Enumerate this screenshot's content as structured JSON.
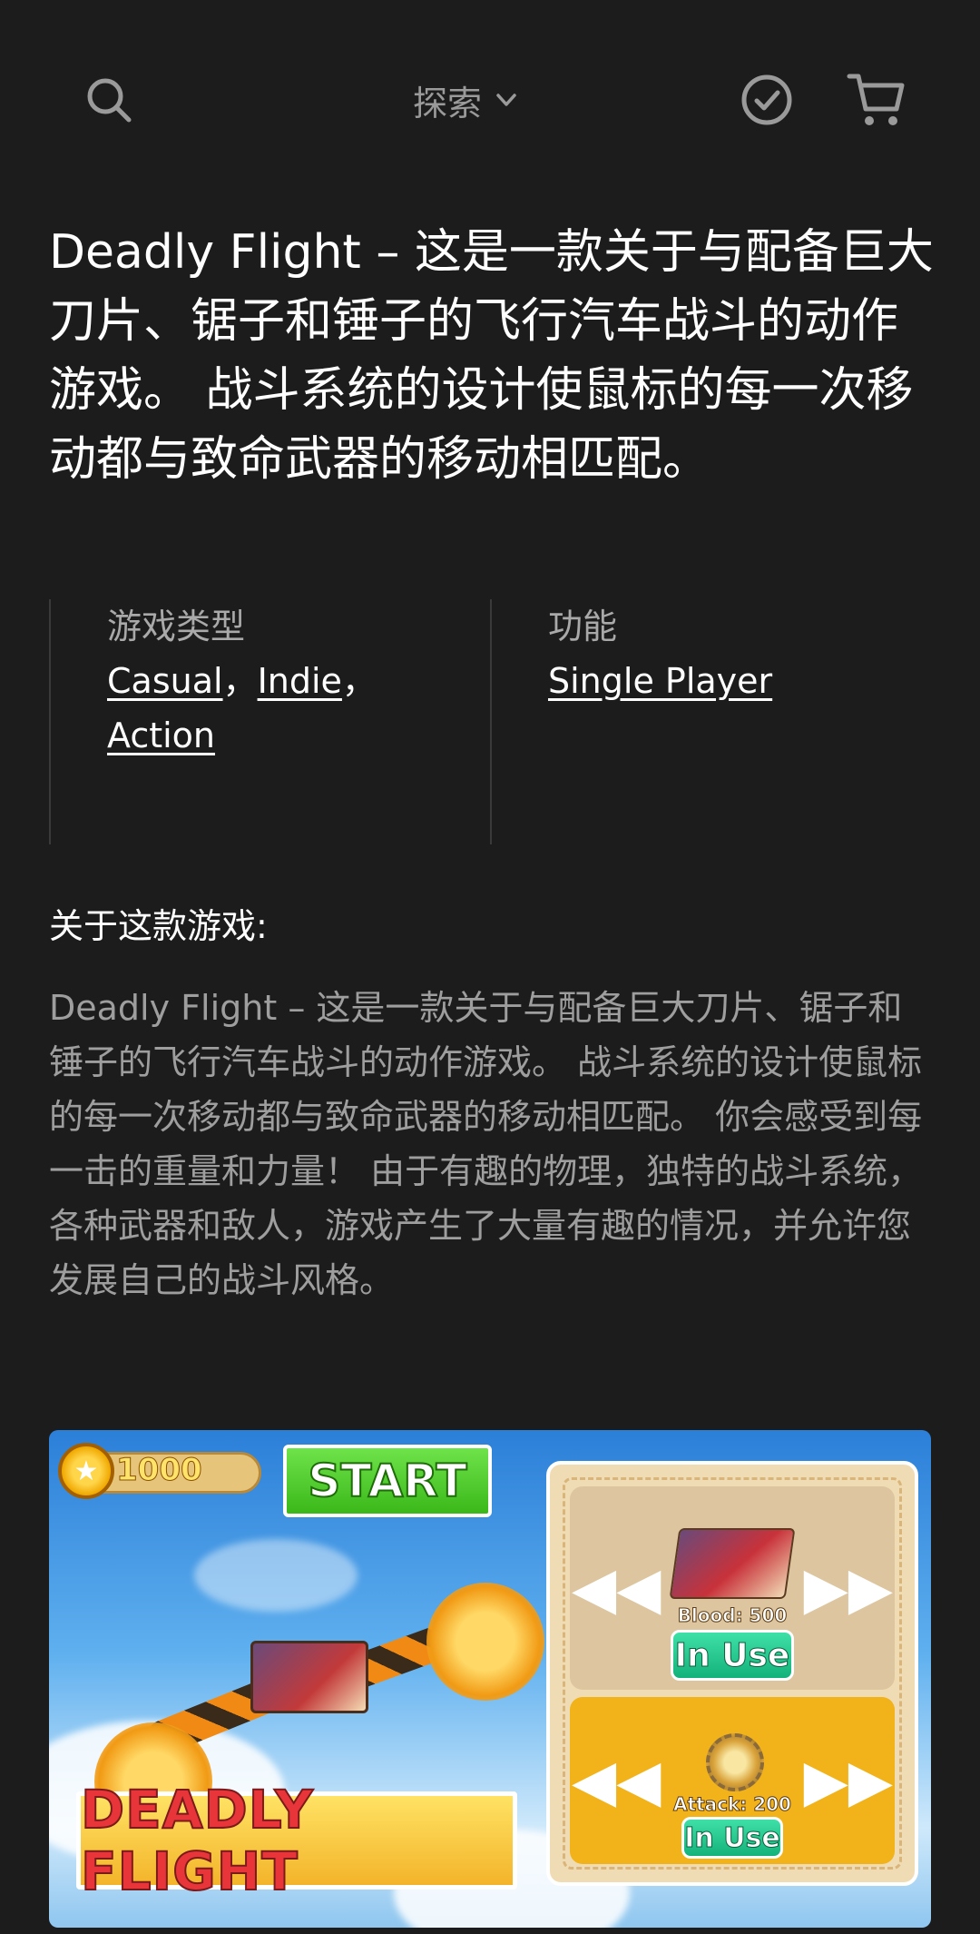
{
  "topbar": {
    "nav_label": "探索",
    "icons": [
      "search-icon",
      "chevron-down-icon",
      "check-circle-icon",
      "cart-icon"
    ]
  },
  "headline": "Deadly Flight – 这是一款关于与配备巨大刀片、锯子和锤子的飞行汽车战斗的动作游戏。 战斗系统的设计使鼠标的每一次移动都与致命武器的移动相匹配。",
  "meta": {
    "genres_title": "游戏类型",
    "genres": [
      "Casual",
      "Indie",
      "Action"
    ],
    "separator": "，",
    "features_title": "功能",
    "features": [
      "Single Player"
    ]
  },
  "about": {
    "title": "关于这款游戏:",
    "body": "Deadly Flight – 这是一款关于与配备巨大刀片、锯子和锤子的飞行汽车战斗的动作游戏。 战斗系统的设计使鼠标的每一次移动都与致命武器的移动相匹配。 你会感受到每一击的重量和力量！ 由于有趣的物理，独特的战斗系统，各种武器和敌人，游戏产生了大量有趣的情况，并允许您发展自己的战斗风格。"
  },
  "screenshot": {
    "coins": "1000",
    "start_label": "START",
    "title_art": "DEADLY FLIGHT",
    "slot1_stat": "Blood: 500",
    "slot1_status": "In Use",
    "slot2_stat": "Attack: 200",
    "slot2_status": "In Use"
  },
  "colors": {
    "background": "#1c1c1d",
    "muted_text": "#9e9e9e",
    "divider": "#3a3a3a"
  }
}
